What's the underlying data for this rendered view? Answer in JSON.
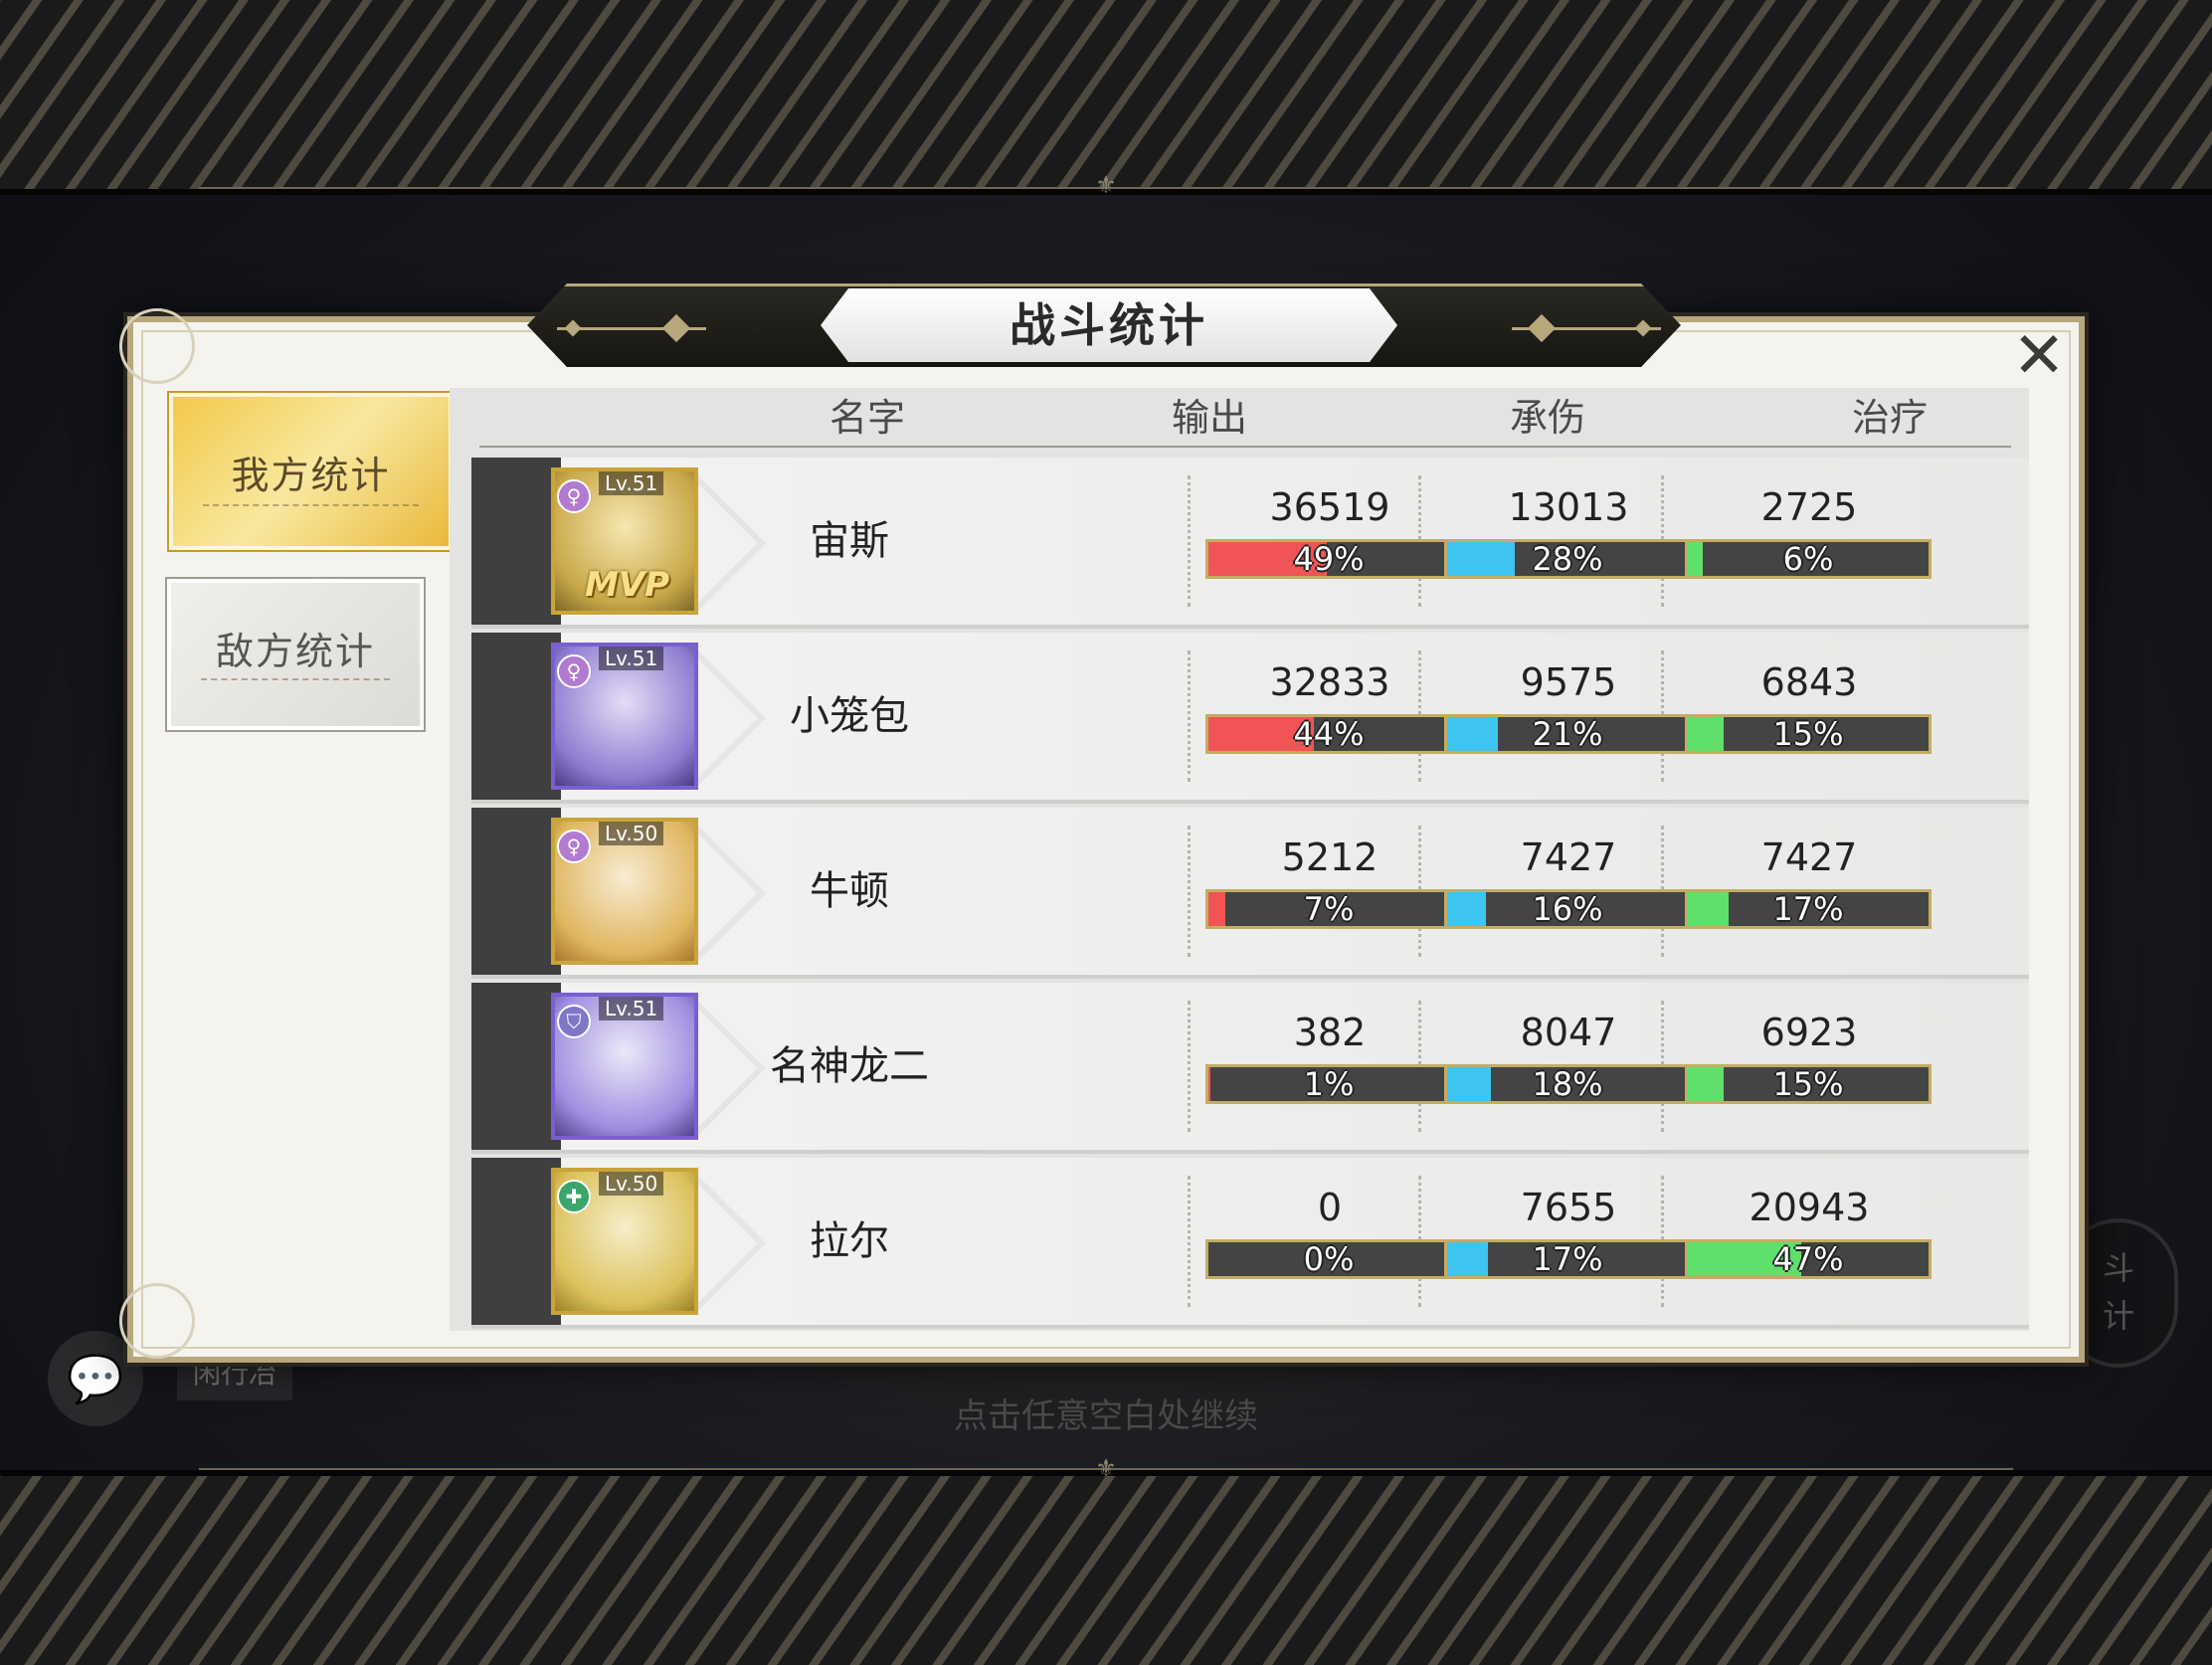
{
  "title": "战斗统计",
  "tabs": [
    {
      "label": "我方统计",
      "active": true
    },
    {
      "label": "敌方统计",
      "active": false
    }
  ],
  "columns": [
    "名字",
    "输出",
    "承伤",
    "治疗"
  ],
  "colors": {
    "damage": "#f05454",
    "taken": "#3ec4f0",
    "heal": "#5ee06a",
    "gold": "#c3ad63"
  },
  "rows": [
    {
      "name": "宙斯",
      "level": "Lv.51",
      "role_icon": "female-symbol-icon",
      "mvp": "MVP",
      "damage": "36519",
      "damage_pct": "49%",
      "damage_frac": 0.49,
      "taken": "13013",
      "taken_pct": "28%",
      "taken_frac": 0.28,
      "heal": "2725",
      "heal_pct": "6%",
      "heal_frac": 0.06
    },
    {
      "name": "小笼包",
      "level": "Lv.51",
      "role_icon": "female-symbol-icon",
      "mvp": "",
      "damage": "32833",
      "damage_pct": "44%",
      "damage_frac": 0.44,
      "taken": "9575",
      "taken_pct": "21%",
      "taken_frac": 0.21,
      "heal": "6843",
      "heal_pct": "15%",
      "heal_frac": 0.15
    },
    {
      "name": "牛顿",
      "level": "Lv.50",
      "role_icon": "female-symbol-icon",
      "mvp": "",
      "damage": "5212",
      "damage_pct": "7%",
      "damage_frac": 0.07,
      "taken": "7427",
      "taken_pct": "16%",
      "taken_frac": 0.16,
      "heal": "7427",
      "heal_pct": "17%",
      "heal_frac": 0.17
    },
    {
      "name": "名神龙二",
      "level": "Lv.51",
      "role_icon": "shield-icon",
      "mvp": "",
      "damage": "382",
      "damage_pct": "1%",
      "damage_frac": 0.01,
      "taken": "8047",
      "taken_pct": "18%",
      "taken_frac": 0.18,
      "heal": "6923",
      "heal_pct": "15%",
      "heal_frac": 0.15
    },
    {
      "name": "拉尔",
      "level": "Lv.50",
      "role_icon": "heal-cross-icon",
      "mvp": "",
      "damage": "0",
      "damage_pct": "0%",
      "damage_frac": 0.0,
      "taken": "7655",
      "taken_pct": "17%",
      "taken_frac": 0.17,
      "heal": "20943",
      "heal_pct": "47%",
      "heal_frac": 0.47
    }
  ],
  "continue_hint": "点击任意空白处继续",
  "chat": {
    "label": "闲行冶"
  },
  "side_button": {
    "label_1": "斗",
    "label_2": "计"
  }
}
